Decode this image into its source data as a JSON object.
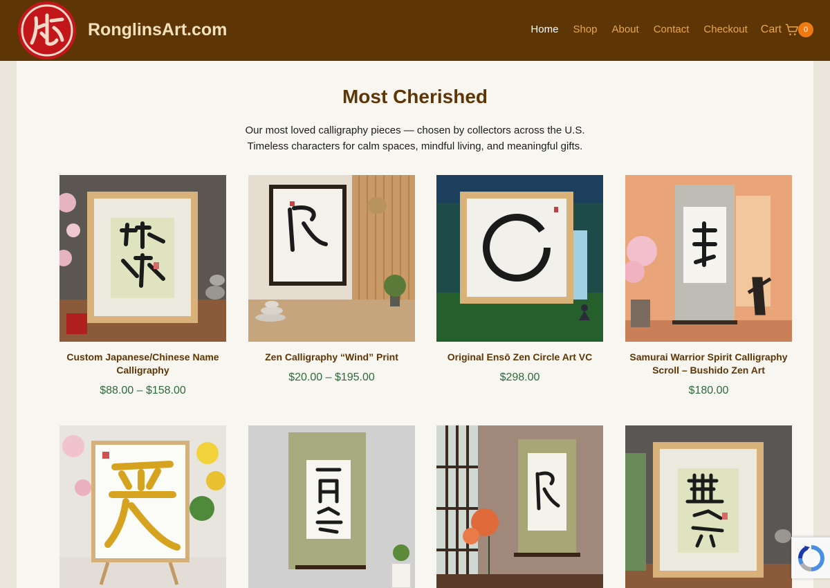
{
  "header": {
    "site_title": "RonglinsArt.com",
    "nav": [
      {
        "label": "Home",
        "active": true
      },
      {
        "label": "Shop",
        "active": false
      },
      {
        "label": "About",
        "active": false
      },
      {
        "label": "Contact",
        "active": false
      },
      {
        "label": "Checkout",
        "active": false
      }
    ],
    "cart_label": "Cart",
    "cart_count": "0"
  },
  "main": {
    "title": "Most Cherished",
    "intro_line1": "Our most loved calligraphy pieces — chosen by collectors across the U.S.",
    "intro_line2": "Timeless characters for calm spaces, mindful living, and meaningful gifts."
  },
  "products": [
    {
      "name": "Custom Japanese/Chinese Name Calligraphy",
      "price": "$88.00 – $158.00",
      "image": "framed-name-calligraphy"
    },
    {
      "name": "Zen Calligraphy “Wind” Print",
      "price": "$20.00 – $195.00",
      "image": "wind-print"
    },
    {
      "name": "Original Ensō Zen Circle Art VC",
      "price": "$298.00",
      "image": "enso-circle"
    },
    {
      "name": "Samurai Warrior Spirit Calligraphy Scroll – Bushido Zen Art",
      "price": "$180.00",
      "image": "samurai-scroll"
    },
    {
      "name": "",
      "price": "",
      "image": "love-gold"
    },
    {
      "name": "",
      "price": "",
      "image": "ichigo-ichie-scroll"
    },
    {
      "name": "",
      "price": "",
      "image": "wind-scroll-window"
    },
    {
      "name": "",
      "price": "",
      "image": "mu-i-framed"
    }
  ],
  "colors": {
    "header_bg": "#5e3504",
    "accent": "#e8a74a",
    "title": "#5e3504",
    "price": "#2d6a3a",
    "badge": "#f07a12"
  },
  "icons": {
    "logo": "red-seal-logo",
    "cart": "cart-icon",
    "recaptcha": "recaptcha-icon"
  }
}
